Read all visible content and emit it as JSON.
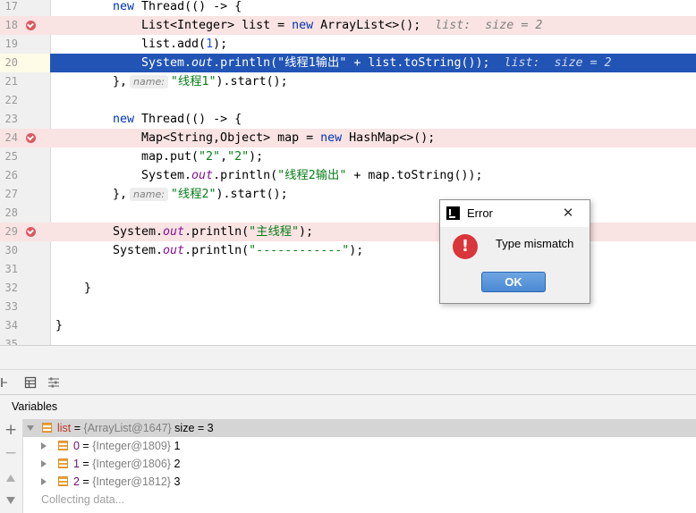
{
  "editor": {
    "lines": [
      {
        "num": "17"
      },
      {
        "num": "18"
      },
      {
        "num": "19"
      },
      {
        "num": "20"
      },
      {
        "num": "21"
      },
      {
        "num": "22"
      },
      {
        "num": "23"
      },
      {
        "num": "24"
      },
      {
        "num": "25"
      },
      {
        "num": "26"
      },
      {
        "num": "27"
      },
      {
        "num": "28"
      },
      {
        "num": "29"
      },
      {
        "num": "30"
      },
      {
        "num": "31"
      },
      {
        "num": "32"
      },
      {
        "num": "33"
      },
      {
        "num": "34"
      },
      {
        "num": "35"
      }
    ],
    "code": {
      "l17_kw": "new",
      "l17_rest": " Thread(() -> {",
      "l18_type": "List<Integer> list = ",
      "l18_kw": "new",
      "l18_rest": " ArrayList<>();",
      "l18_hint": "list:  size = 2",
      "l19_a": "list.add(",
      "l19_num": "1",
      "l19_b": ");",
      "l20_a": "System.",
      "l20_fld": "out",
      "l20_b": ".println(",
      "l20_str": "\"线程1输出\"",
      "l20_c": " + list.toString());",
      "l20_hint": "list:  size = 2",
      "l21_a": "},",
      "l21_inlay": "name:",
      "l21_str": "\"线程1\"",
      "l21_b": ").start();",
      "l23_kw": "new",
      "l23_rest": " Thread(() -> {",
      "l24_type": "Map<String,Object> map = ",
      "l24_kw": "new",
      "l24_rest": " HashMap<>();",
      "l25_a": "map.put(",
      "l25_s1": "\"2\"",
      "l25_comma": ",",
      "l25_s2": "\"2\"",
      "l25_b": ");",
      "l26_a": "System.",
      "l26_fld": "out",
      "l26_b": ".println(",
      "l26_str": "\"线程2输出\"",
      "l26_c": " + map.toString());",
      "l27_a": "},",
      "l27_inlay": "name:",
      "l27_str": "\"线程2\"",
      "l27_b": ").start();",
      "l29_a": "System.",
      "l29_fld": "out",
      "l29_b": ".println(",
      "l29_str": "\"主线程\"",
      "l29_c": ");",
      "l30_a": "System.",
      "l30_fld": "out",
      "l30_b": ".println(",
      "l30_str": "\"------------\"",
      "l30_c": ");",
      "l32": "}",
      "l34": "}"
    }
  },
  "panel": {
    "variables_title": "Variables",
    "add_btn": "+",
    "remove_btn": "−",
    "tree": {
      "root_name": "list",
      "root_eq": " = ",
      "root_type": "{ArrayList@1647}",
      "root_size": "  size = 3",
      "items": [
        {
          "name": "0",
          "type": "{Integer@1809}",
          "value": " 1"
        },
        {
          "name": "1",
          "type": "{Integer@1806}",
          "value": " 2"
        },
        {
          "name": "2",
          "type": "{Integer@1812}",
          "value": " 3"
        }
      ],
      "collecting": "Collecting data..."
    }
  },
  "dialog": {
    "title": "Error",
    "close_glyph": "✕",
    "icon_glyph": "!",
    "message": "Type mismatch",
    "ok_label": "OK"
  }
}
